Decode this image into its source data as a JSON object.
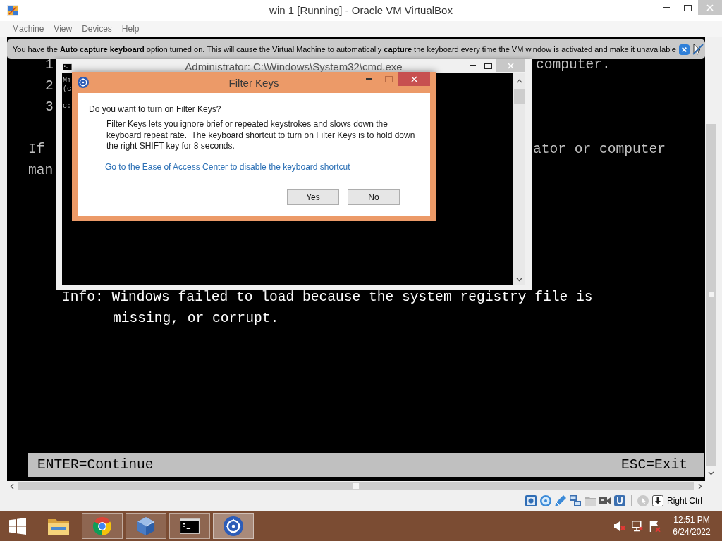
{
  "window": {
    "title": "win 1 [Running] - Oracle VM VirtualBox"
  },
  "menu": [
    "Machine",
    "View",
    "Devices",
    "Help"
  ],
  "notification": {
    "text": "You have the **Auto capture keyboard** option turned on. This will cause the Virtual Machine to automatically **capture** the keyboard every time the VM window is activated and make it unavailable"
  },
  "console": {
    "lines": [
      [
        "1",
        "computer."
      ],
      [
        "2"
      ],
      [
        "3"
      ],
      [
        "If",
        "ator or computer"
      ],
      [
        "man"
      ],
      [
        "Info: Windows failed to load because the system registry file is"
      ],
      [
        "missing, or corrupt."
      ]
    ],
    "footer": {
      "left": "ENTER=Continue",
      "right": "ESC=Exit"
    }
  },
  "cmd_window": {
    "title": "Administrator: C:\\Windows\\System32\\cmd.exe",
    "lines": [
      "Mi",
      "(c",
      "c:"
    ]
  },
  "dialog": {
    "title": "Filter Keys",
    "question": "Do you want to turn on Filter Keys?",
    "description": "Filter Keys lets you ignore brief or repeated keystrokes and slows down the keyboard repeat rate.  The keyboard shortcut to turn on Filter Keys is to hold down the right SHIFT key for 8 seconds.",
    "link": "Go to the Ease of Access Center to disable the keyboard shortcut",
    "buttons": [
      "Yes",
      "No"
    ]
  },
  "status_bar": {
    "host_key": "Right Ctrl"
  },
  "taskbar": {
    "apps": [
      {
        "kind": "explorer",
        "running": false,
        "selected": false
      },
      {
        "kind": "chrome",
        "running": true,
        "selected": false
      },
      {
        "kind": "virtualbox",
        "running": true,
        "selected": false
      },
      {
        "kind": "terminal",
        "running": true,
        "selected": false
      },
      {
        "kind": "ease_of_access",
        "running": true,
        "selected": true
      }
    ],
    "clock": {
      "time": "12:51 PM",
      "date": "6/24/2022"
    }
  }
}
